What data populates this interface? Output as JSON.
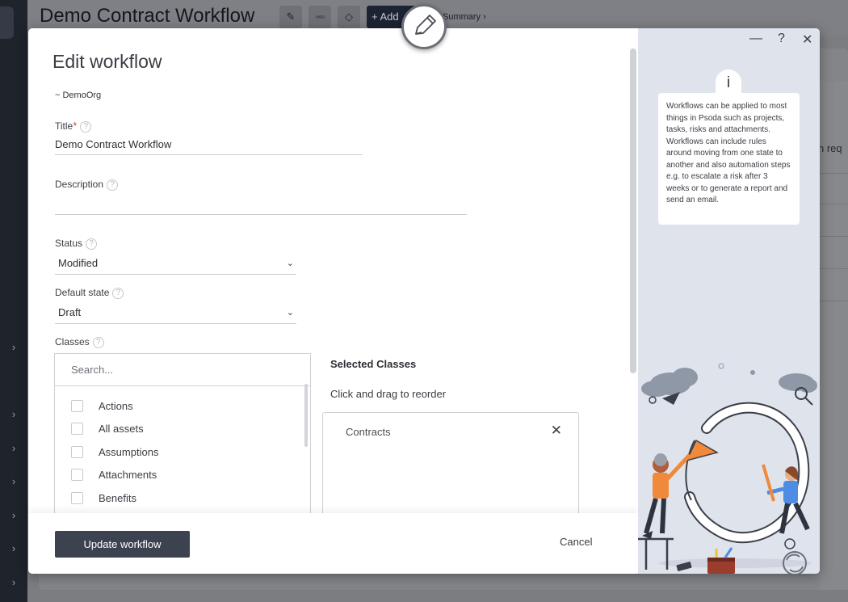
{
  "background": {
    "page_title": "Demo Contract Workflow",
    "add_label": "+ Add",
    "breadcrumb": "Summary ›",
    "side_text": "n req"
  },
  "modal": {
    "title": "Edit workflow",
    "org": "~ DemoOrg",
    "title_field": {
      "label": "Title",
      "required_mark": "*",
      "value": "Demo Contract Workflow"
    },
    "description_field": {
      "label": "Description",
      "value": ""
    },
    "status_field": {
      "label": "Status",
      "value": "Modified"
    },
    "default_state_field": {
      "label": "Default state",
      "value": "Draft"
    },
    "classes": {
      "label": "Classes",
      "search_placeholder": "Search...",
      "items": [
        {
          "label": "Actions",
          "checked": false
        },
        {
          "label": "All assets",
          "checked": false
        },
        {
          "label": "Assumptions",
          "checked": false
        },
        {
          "label": "Attachments",
          "checked": false
        },
        {
          "label": "Benefits",
          "checked": false
        }
      ]
    },
    "selected_classes": {
      "title": "Selected Classes",
      "hint": "Click and drag to reorder",
      "items": [
        {
          "label": "Contracts"
        }
      ]
    },
    "footer": {
      "update_label": "Update workflow",
      "cancel_label": "Cancel"
    },
    "side_panel": {
      "info_icon": "i",
      "info_text": "Workflows can be applied to most things in Psoda such as projects, tasks, risks and attachments. Workflows can include rules around moving from one state to another and also automation steps e.g. to escalate a risk after 3 weeks or to generate a report and send an email.",
      "window_controls": {
        "minimize": "—",
        "help": "?",
        "close": "✕"
      }
    }
  },
  "colors": {
    "primary_button": "#3d4250",
    "required": "#d9453b",
    "side_panel_bg": "#dfe3ec",
    "illustration_orange": "#f08a3a",
    "illustration_blue": "#4e8de3"
  }
}
